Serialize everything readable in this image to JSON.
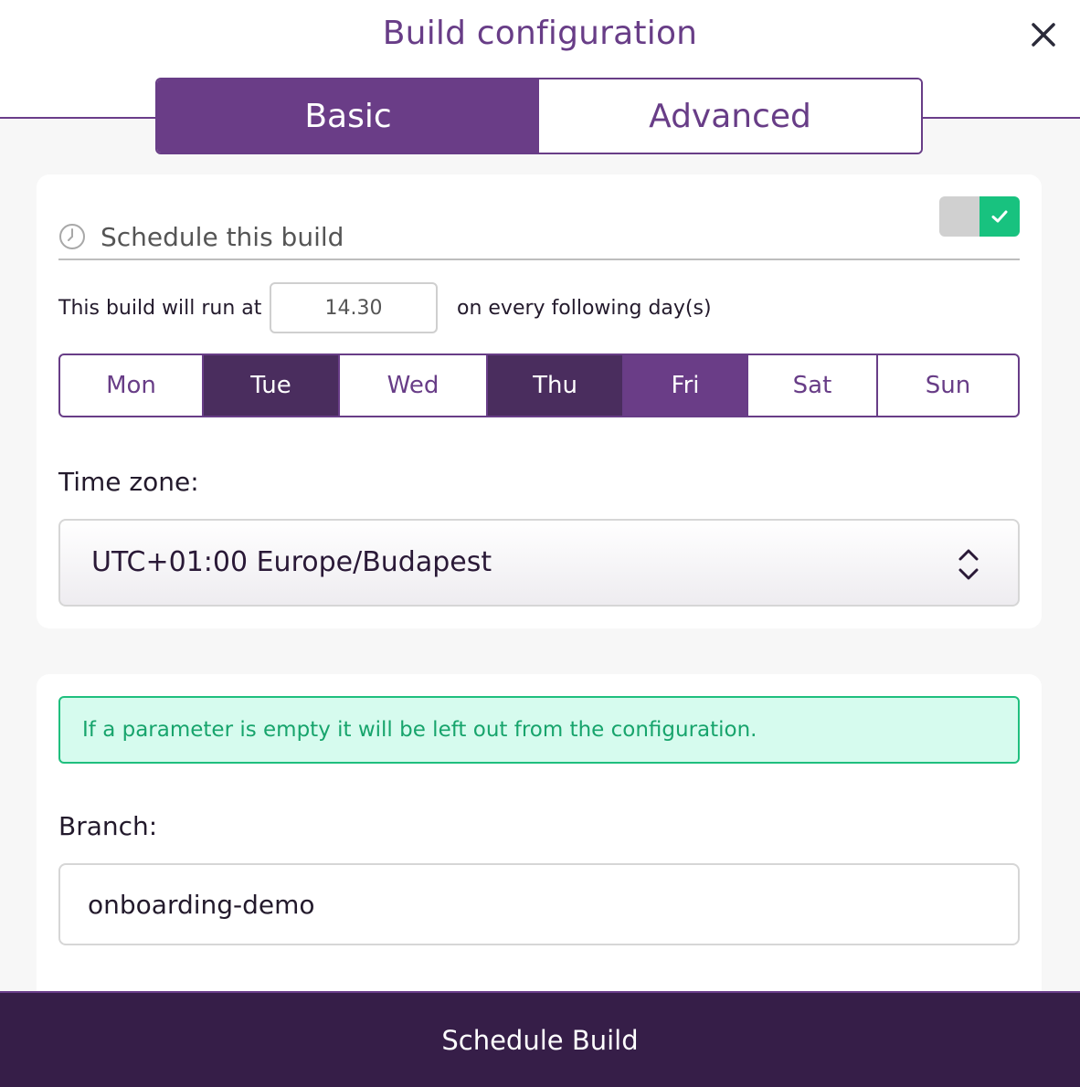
{
  "dialog": {
    "title": "Build configuration",
    "close_icon": "close-icon"
  },
  "tabs": [
    {
      "label": "Basic",
      "active": true
    },
    {
      "label": "Advanced",
      "active": false
    }
  ],
  "schedule": {
    "label": "Schedule this build",
    "icon": "clock-icon",
    "enabled": true,
    "run_text_before": "This build will run at",
    "time": "14.30",
    "run_text_after": "on every following day(s)",
    "days": [
      {
        "label": "Mon",
        "selected": false
      },
      {
        "label": "Tue",
        "selected": true
      },
      {
        "label": "Wed",
        "selected": false
      },
      {
        "label": "Thu",
        "selected": true
      },
      {
        "label": "Fri",
        "selected": true
      },
      {
        "label": "Sat",
        "selected": false
      },
      {
        "label": "Sun",
        "selected": false
      }
    ],
    "timezone_label": "Time zone:",
    "timezone_value": "UTC+01:00 Europe/Budapest"
  },
  "params": {
    "notice": "If a parameter is empty it will be left out from the configuration.",
    "branch_label": "Branch:",
    "branch_value": "onboarding-demo"
  },
  "footer": {
    "button_label": "Schedule Build"
  },
  "colors": {
    "primary": "#6a3d87",
    "dark": "#361e48",
    "success": "#18c27f",
    "notice_bg": "#d6fbee"
  }
}
